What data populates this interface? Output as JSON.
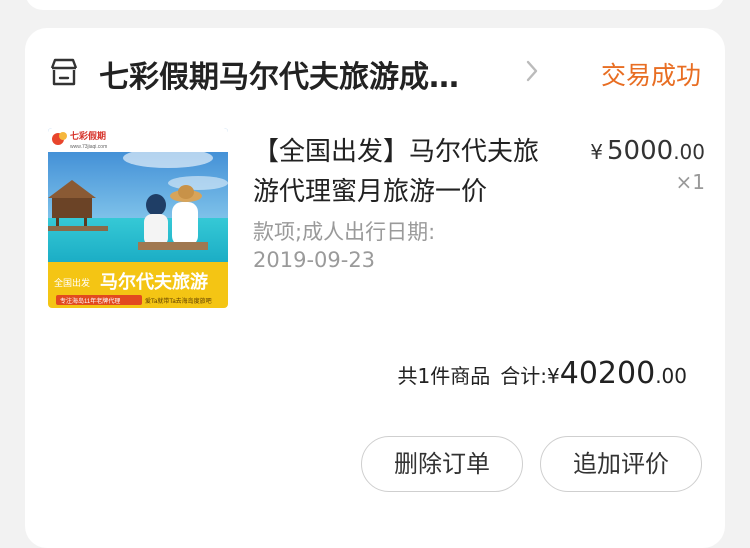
{
  "order": {
    "shop_name": "七彩假期马尔代夫旅游成…",
    "status": "交易成功",
    "product": {
      "title": "【全国出发】马尔代夫旅游代理蜜月旅游一价",
      "spec_label": "款项;成人出行日期:",
      "spec_value": "2019-09-23",
      "price_currency": "¥",
      "price_int": "5000",
      "price_dec": ".00",
      "quantity": "×1",
      "image": {
        "logo_text": "七彩假期",
        "logo_url": "www.73jiaqi.com",
        "banner_prefix": "全国出发",
        "banner_title": "马尔代夫旅游",
        "banner_sub_left": "专注海岛11年老牌代理",
        "banner_sub_right": "爱Ta就带Ta去海岛度旅吧"
      }
    },
    "summary": {
      "count_text": "共1件商品",
      "total_label": "合计:",
      "currency": "¥",
      "total_int": "40200",
      "total_dec": ".00"
    },
    "buttons": {
      "delete": "删除订单",
      "review": "追加评价"
    }
  },
  "colors": {
    "status": "#e86e23",
    "background": "#f2f2f2",
    "card": "#ffffff"
  }
}
